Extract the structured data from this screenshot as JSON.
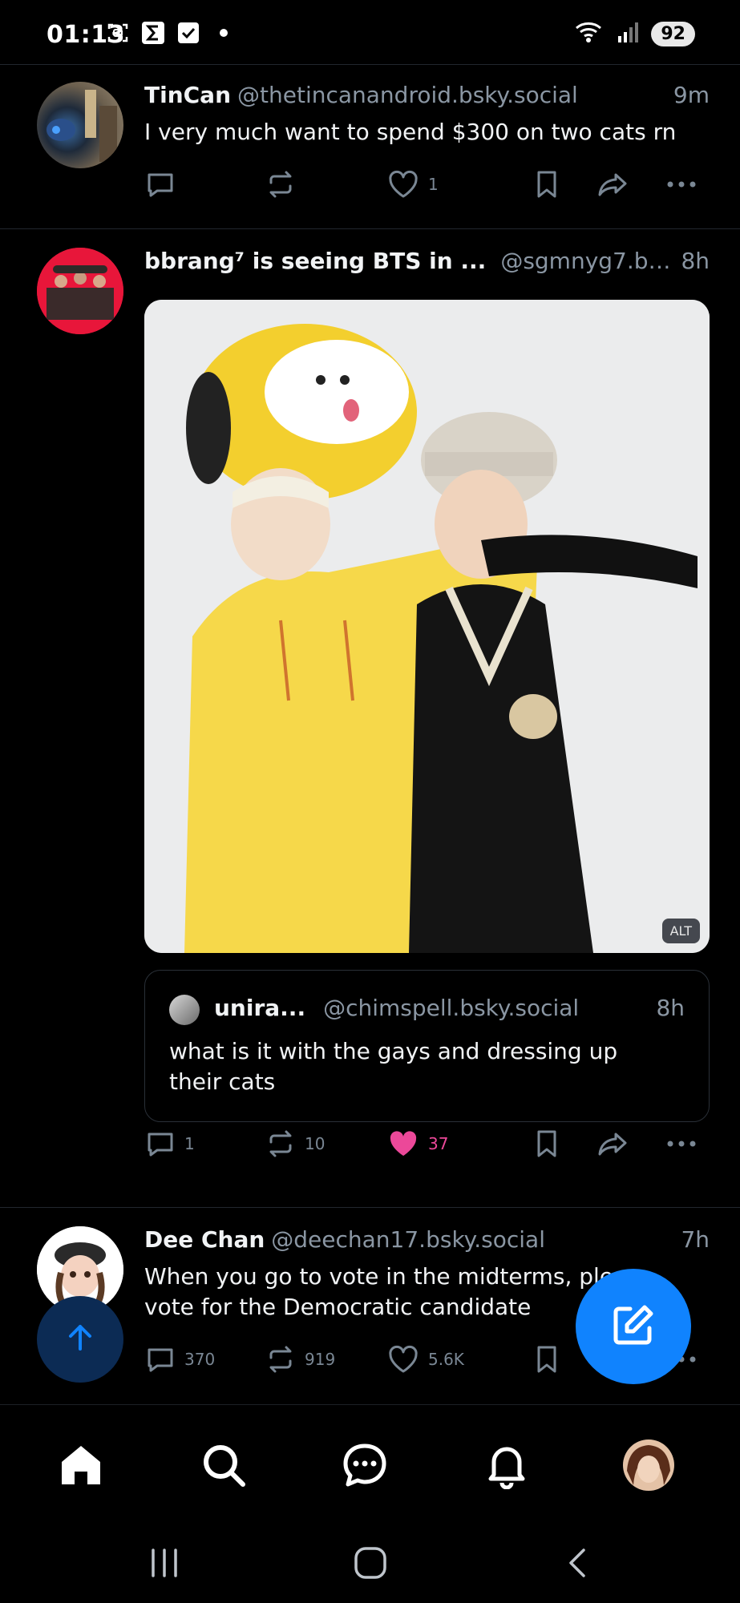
{
  "status_bar": {
    "time": "01:13",
    "battery": "92",
    "icons": [
      "screenshot-icon",
      "sigma-app-icon",
      "checkbox-icon",
      "dot-icon",
      "wifi-icon",
      "signal-icon"
    ]
  },
  "feed": [
    {
      "name": "TinCan",
      "handle": "@thetincanandroid.bsky.social",
      "time": "9m",
      "text": "I very much want to spend $300 on two cats rn",
      "replies": "",
      "reposts": "",
      "likes": "1",
      "liked": false
    },
    {
      "name": "bbrang⁷ is seeing BTS in ...",
      "handle": "@sgmnyg7.bsk...",
      "time": "8h",
      "text": "",
      "image_alt_badge": "ALT",
      "quote": {
        "name": "unira...",
        "handle": "@chimspell.bsky.social",
        "time": "8h",
        "text": "what is it with the gays and dressing up their cats"
      },
      "replies": "1",
      "reposts": "10",
      "likes": "37",
      "liked": true
    },
    {
      "name": "Dee Chan",
      "handle": "@deechan17.bsky.social",
      "time": "7h",
      "text": "When you go to vote in the midterms, please vote for the Democratic candidate",
      "replies": "370",
      "reposts": "919",
      "likes": "5.6K",
      "liked": false
    }
  ],
  "colors": {
    "background": "#000000",
    "accent": "#1083fe",
    "like": "#ec4899",
    "muted": "#8a96a3"
  },
  "bottom_nav": [
    "home-icon",
    "search-icon",
    "chat-icon",
    "bell-icon",
    "profile-avatar"
  ],
  "system_nav": [
    "recents-icon",
    "home-circle-icon",
    "back-icon"
  ]
}
